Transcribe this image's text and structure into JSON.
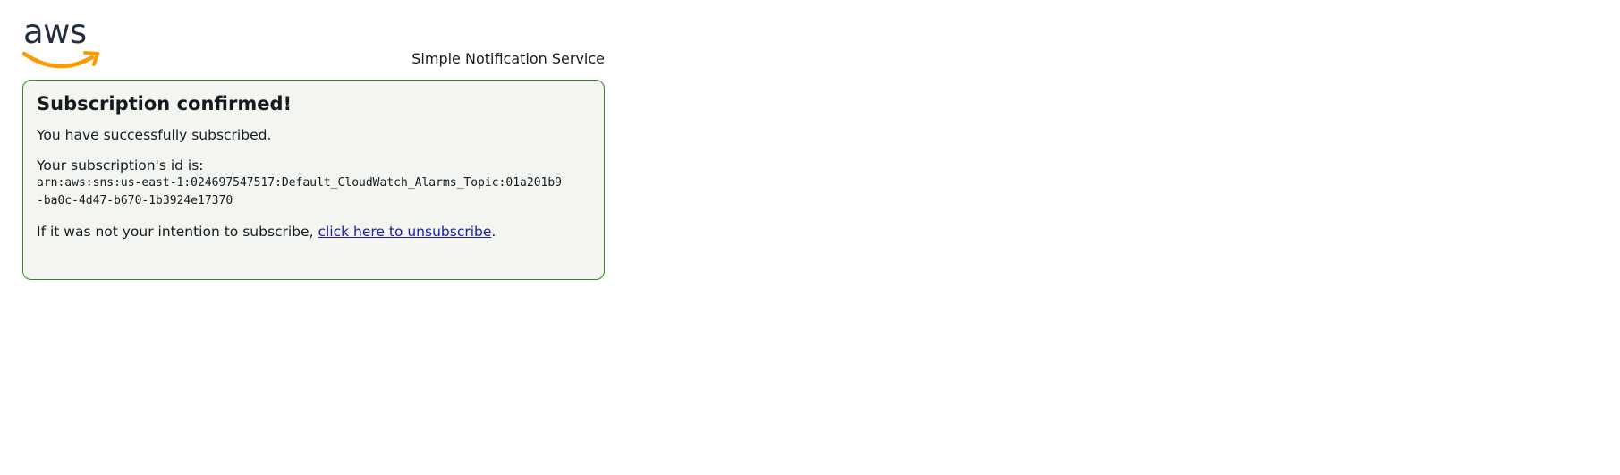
{
  "header": {
    "logo_text": "aws",
    "service_name": "Simple Notification Service"
  },
  "card": {
    "title": "Subscription confirmed!",
    "success_message": "You have successfully subscribed.",
    "id_label": "Your subscription's id is:",
    "subscription_arn": "arn:aws:sns:us-east-1:024697547517:Default_CloudWatch_Alarms_Topic:01a201b9-ba0c-4d47-b670-1b3924e17370",
    "unsubscribe_prefix": "If it was not your intention to subscribe, ",
    "unsubscribe_link": "click here to unsubscribe",
    "unsubscribe_suffix": "."
  },
  "colors": {
    "card_border": "#2f8a23",
    "card_background": "#f2f5f0",
    "link": "#1a1aa6",
    "logo_smile": "#ff9900",
    "logo_text": "#232f3e"
  },
  "icons": {
    "logo": "aws-logo-icon"
  }
}
